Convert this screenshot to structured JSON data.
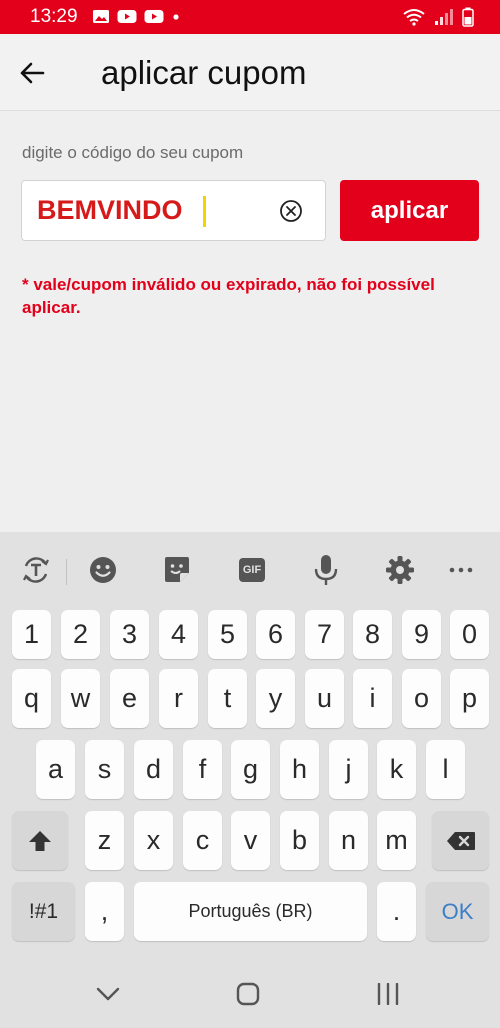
{
  "status_bar": {
    "time": "13:29",
    "icons_left": [
      "gallery-icon",
      "youtube-icon",
      "youtube-icon",
      "notification-dot-icon"
    ],
    "icons_right": [
      "wifi-icon",
      "signal-icon",
      "battery-icon"
    ]
  },
  "app_bar": {
    "title": "aplicar cupom"
  },
  "coupon": {
    "prompt": "digite o código do seu cupom",
    "input_value": "BEMVINDO",
    "apply_label": "aplicar",
    "error": "* vale/cupom inválido ou expirado, não foi possível aplicar."
  },
  "keyboard": {
    "toolbar": [
      "translate-icon",
      "emoji-icon",
      "sticker-icon",
      "gif-icon",
      "mic-icon",
      "settings-icon",
      "more-icon"
    ],
    "row_numbers": [
      "1",
      "2",
      "3",
      "4",
      "5",
      "6",
      "7",
      "8",
      "9",
      "0"
    ],
    "row_1": [
      "q",
      "w",
      "e",
      "r",
      "t",
      "y",
      "u",
      "i",
      "o",
      "p"
    ],
    "row_2": [
      "a",
      "s",
      "d",
      "f",
      "g",
      "h",
      "j",
      "k",
      "l"
    ],
    "row_3": [
      "z",
      "x",
      "c",
      "v",
      "b",
      "n",
      "m"
    ],
    "symbols_label": "!#1",
    "comma_label": ",",
    "space_label": "Português (BR)",
    "period_label": ".",
    "ok_label": "OK",
    "gif_label": "GIF"
  },
  "colors": {
    "brand_red": "#e3001b",
    "input_text_red": "#d61a1a",
    "ok_blue": "#3d7fc7"
  }
}
